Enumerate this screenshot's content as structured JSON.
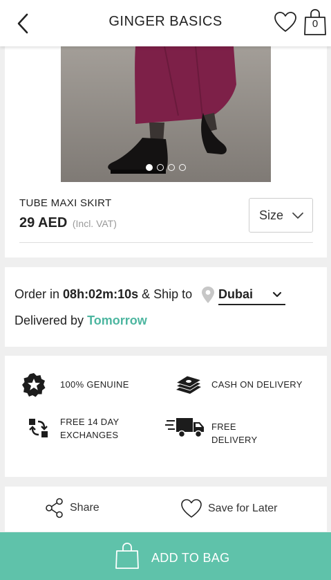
{
  "header": {
    "title": "GINGER BASICS",
    "bag_count": "0"
  },
  "product": {
    "name": "TUBE MAXI SKIRT",
    "price": "29 AED",
    "vat_note": "(Incl. VAT)",
    "size_label": "Size",
    "image_count": 4,
    "active_image": 1
  },
  "delivery": {
    "order_prefix": "Order in",
    "countdown": "08h:02m:10s",
    "ship_to": "& Ship to",
    "city": "Dubai",
    "delivered_by": "Delivered by",
    "delivery_day": "Tomorrow"
  },
  "features": [
    {
      "icon": "star-badge-icon",
      "line1": "100% GENUINE",
      "line2": ""
    },
    {
      "icon": "cash-stack-icon",
      "line1": "CASH ON DELIVERY",
      "line2": ""
    },
    {
      "icon": "exchange-icon",
      "line1": "FREE 14 DAY",
      "line2": "EXCHANGES"
    },
    {
      "icon": "delivery-truck-icon",
      "line1": "FREE",
      "line2": "DELIVERY"
    }
  ],
  "actions": {
    "share_label": "Share",
    "save_label": "Save for Later",
    "add_to_bag_label": "ADD TO BAG"
  },
  "colors": {
    "accent": "#5fc2aa",
    "delivery_day": "#4db6a0",
    "skirt": "#7d2048"
  }
}
